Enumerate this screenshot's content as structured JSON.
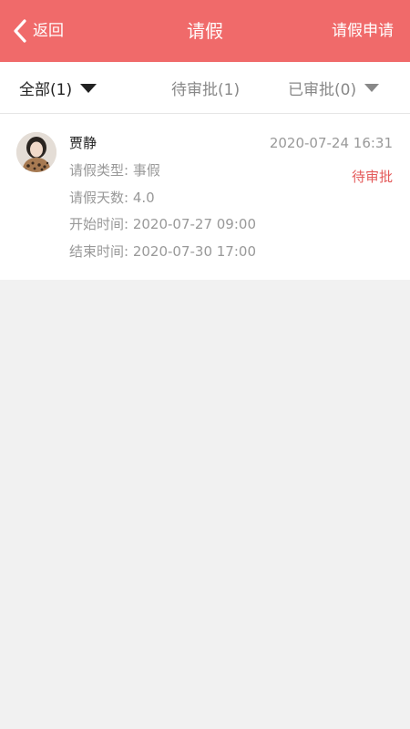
{
  "header": {
    "back_label": "返回",
    "title": "请假",
    "apply_label": "请假申请",
    "background": "#f06a6a"
  },
  "filters": {
    "all": "全部(1)",
    "pending": "待审批(1)",
    "approved": "已审批(0)"
  },
  "records": [
    {
      "name": "贾静",
      "time": "2020-07-24 16:31",
      "status": "待审批",
      "status_color": "#e45a5a",
      "type_line": "请假类型: 事假",
      "days_line": "请假天数: 4.0",
      "start_line": "开始时间: 2020-07-27 09:00",
      "end_line": "结束时间: 2020-07-30 17:00"
    }
  ],
  "icons": {
    "back": "chevron-left-icon",
    "dropdown": "triangle-down-icon"
  }
}
